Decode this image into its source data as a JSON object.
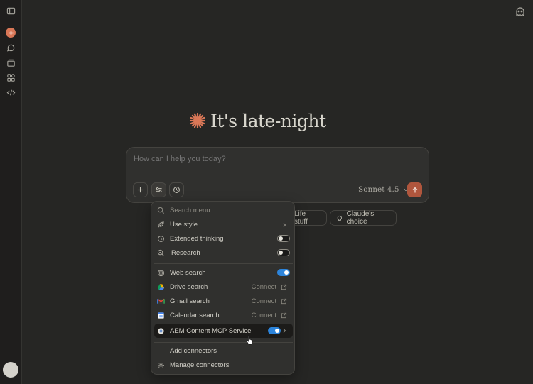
{
  "sidebar": {
    "icons": [
      "sidebar-toggle-icon",
      "new-chat-icon",
      "chats-icon",
      "projects-icon",
      "artifacts-icon",
      "code-icon"
    ]
  },
  "greeting": {
    "text": "It's late-night"
  },
  "composer": {
    "placeholder": "How can I help you today?",
    "model": "Sonnet 4.5"
  },
  "chips": [
    {
      "label": "Life stuff"
    },
    {
      "label": "Claude's choice"
    }
  ],
  "menu": {
    "search_placeholder": "Search menu",
    "items": [
      {
        "label": "Use style"
      },
      {
        "label": "Extended thinking",
        "toggle": false
      },
      {
        "label": "Research",
        "toggle": false
      },
      {
        "label": "Web search",
        "toggle": true
      },
      {
        "label": "Drive search",
        "action": "Connect"
      },
      {
        "label": "Gmail search",
        "action": "Connect"
      },
      {
        "label": "Calendar search",
        "action": "Connect"
      },
      {
        "label": "AEM Content MCP Service",
        "toggle": true
      },
      {
        "label": "Add connectors"
      },
      {
        "label": "Manage connectors"
      }
    ]
  },
  "colors": {
    "accent": "#d97757",
    "toggle_on": "#2c84db",
    "background": "#262624"
  }
}
